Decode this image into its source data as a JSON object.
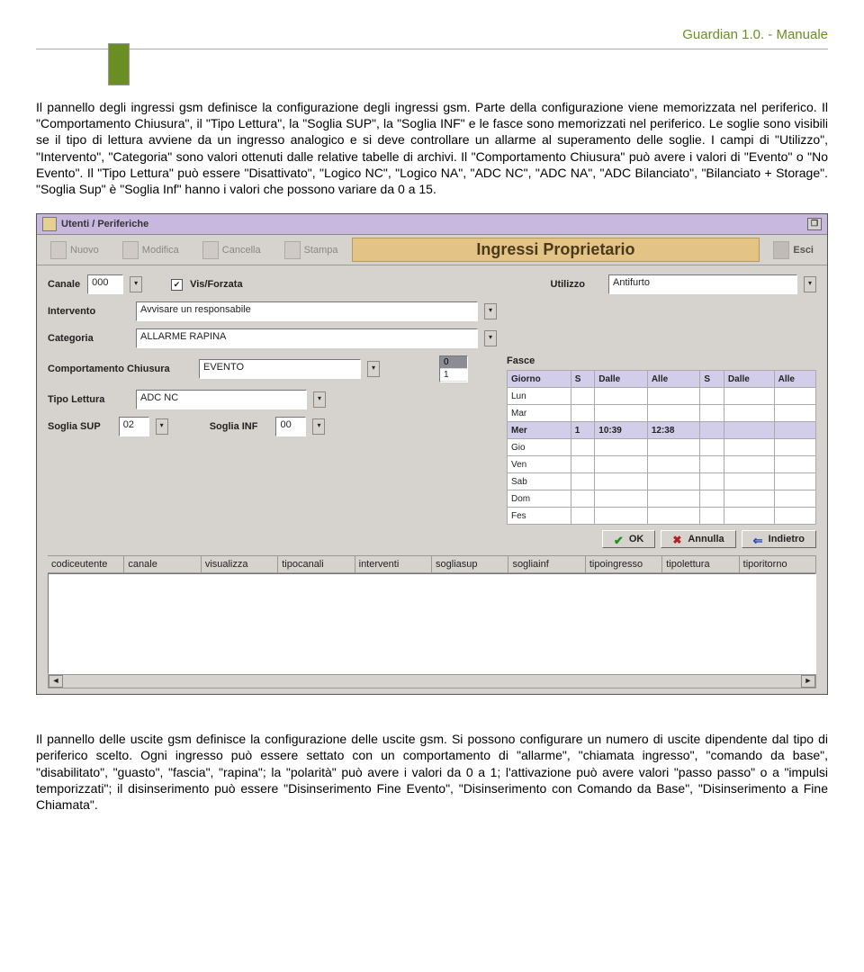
{
  "header": {
    "title": "Guardian 1.0. - Manuale"
  },
  "para1": "Il pannello degli ingressi gsm definisce la configurazione degli ingressi gsm. Parte della configurazione viene memorizzata nel periferico. Il \"Comportamento Chiusura\", il \"Tipo Lettura\", la \"Soglia SUP\", la \"Soglia INF\" e le fasce sono memorizzati nel periferico. Le soglie sono visibili se il tipo di lettura avviene da un ingresso analogico e si deve controllare un allarme al superamento delle soglie. I campi di \"Utilizzo\", \"Intervento\", \"Categoria\" sono valori ottenuti dalle relative tabelle di archivi. Il \"Comportamento Chiusura\" può avere i valori di \"Evento\" o \"No Evento\". Il \"Tipo Lettura\" può essere \"Disattivato\", \"Logico NC\", \"Logico NA\", \"ADC NC\", \"ADC NA\", \"ADC Bilanciato\", \"Bilanciato + Storage\". \"Soglia Sup\" è \"Soglia Inf\" hanno i valori che possono variare da 0 a 15.",
  "window": {
    "title": "Utenti / Periferiche",
    "toolbar": {
      "nuovo": "Nuovo",
      "modifica": "Modifica",
      "cancella": "Cancella",
      "stampa": "Stampa",
      "center": "Ingressi Proprietario",
      "esci": "Esci"
    },
    "form": {
      "canale_label": "Canale",
      "canale_value": "000",
      "vis_label": "Vis/Forzata",
      "vis_checked": "✔",
      "utilizzo_label": "Utilizzo",
      "utilizzo_value": "Antifurto",
      "intervento_label": "Intervento",
      "intervento_value": "Avvisare un responsabile",
      "categoria_label": "Categoria",
      "categoria_value": "ALLARME RAPINA",
      "comp_label": "Comportamento Chiusura",
      "comp_value": "EVENTO",
      "tipo_label": "Tipo Lettura",
      "tipo_value": "ADC NC",
      "sup_label": "Soglia SUP",
      "sup_value": "02",
      "inf_label": "Soglia INF",
      "inf_value": "00",
      "mini0": "0",
      "mini1": "1"
    },
    "fasce": {
      "title": "Fasce",
      "headers": [
        "Giorno",
        "S",
        "Dalle",
        "Alle",
        "S",
        "Dalle",
        "Alle"
      ],
      "rows": [
        {
          "g": "Lun",
          "s1": "",
          "d1": "",
          "a1": "",
          "s2": "",
          "d2": "",
          "a2": ""
        },
        {
          "g": "Mar",
          "s1": "",
          "d1": "",
          "a1": "",
          "s2": "",
          "d2": "",
          "a2": ""
        },
        {
          "g": "Mer",
          "s1": "1",
          "d1": "10:39",
          "a1": "12:38",
          "s2": "",
          "d2": "",
          "a2": "",
          "hl": true
        },
        {
          "g": "Gio",
          "s1": "",
          "d1": "",
          "a1": "",
          "s2": "",
          "d2": "",
          "a2": ""
        },
        {
          "g": "Ven",
          "s1": "",
          "d1": "",
          "a1": "",
          "s2": "",
          "d2": "",
          "a2": ""
        },
        {
          "g": "Sab",
          "s1": "",
          "d1": "",
          "a1": "",
          "s2": "",
          "d2": "",
          "a2": ""
        },
        {
          "g": "Dom",
          "s1": "",
          "d1": "",
          "a1": "",
          "s2": "",
          "d2": "",
          "a2": ""
        },
        {
          "g": "Fes",
          "s1": "",
          "d1": "",
          "a1": "",
          "s2": "",
          "d2": "",
          "a2": ""
        }
      ]
    },
    "actions": {
      "ok": "OK",
      "annulla": "Annulla",
      "indietro": "Indietro"
    },
    "columns": [
      "codiceutente",
      "canale",
      "visualizza",
      "tipocanali",
      "interventi",
      "sogliasup",
      "sogliainf",
      "tipoingresso",
      "tipolettura",
      "tiporitorno"
    ]
  },
  "para2": "Il pannello delle uscite gsm definisce la configurazione delle uscite gsm. Si possono configurare un numero di uscite dipendente dal tipo di periferico scelto. Ogni ingresso può essere settato con un comportamento di \"allarme\", \"chiamata ingresso\", \"comando da base\", \"disabilitato\", \"guasto\", \"fascia\", \"rapina\"; la \"polarità\" può avere i valori da 0 a 1; l'attivazione può avere valori \"passo passo\" o a \"impulsi temporizzati\"; il disinserimento può essere \"Disinserimento Fine Evento\", \"Disinserimento con Comando da Base\", \"Disinserimento a Fine Chiamata\"."
}
